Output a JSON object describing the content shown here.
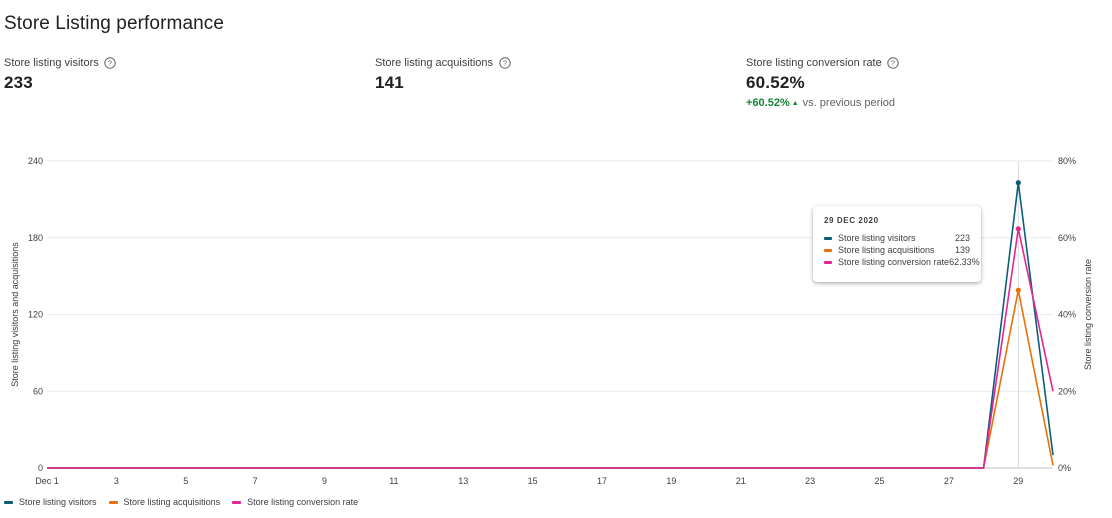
{
  "page": {
    "title": "Store Listing performance"
  },
  "metrics": [
    {
      "label": "Store listing visitors",
      "value": "233",
      "icon": "help-circle-icon"
    },
    {
      "label": "Store listing acquisitions",
      "value": "141",
      "icon": "help-circle-icon"
    },
    {
      "label": "Store listing conversion rate",
      "value": "60.52%",
      "icon": "help-circle-icon",
      "delta": {
        "value": "+60.52%",
        "direction": "up",
        "suffix": "vs. previous period",
        "color": "#188038"
      }
    }
  ],
  "tooltip": {
    "date": "29 DEC 2020",
    "rows": [
      {
        "label": "Store listing visitors",
        "value": "223",
        "color": "#0b5f76"
      },
      {
        "label": "Store listing acquisitions",
        "value": "139",
        "color": "#e8710a"
      },
      {
        "label": "Store listing conversion rate",
        "value": "62.33%",
        "color": "#e52592"
      }
    ]
  },
  "chart_data": {
    "type": "line",
    "x": [
      1,
      2,
      3,
      4,
      5,
      6,
      7,
      8,
      9,
      10,
      11,
      12,
      13,
      14,
      15,
      16,
      17,
      18,
      19,
      20,
      21,
      22,
      23,
      24,
      25,
      26,
      27,
      28,
      29,
      30
    ],
    "x_ticks": [
      1,
      3,
      5,
      7,
      9,
      11,
      13,
      15,
      17,
      19,
      21,
      23,
      25,
      27,
      29
    ],
    "x_tick_labels": [
      "Dec 1",
      "3",
      "5",
      "7",
      "9",
      "11",
      "13",
      "15",
      "17",
      "19",
      "21",
      "23",
      "25",
      "27",
      "29"
    ],
    "y_left": {
      "label": "Store listing visitors and acquisitions",
      "lim": [
        0,
        240
      ],
      "ticks": [
        0,
        60,
        120,
        180,
        240
      ],
      "tick_labels": [
        "0",
        "60",
        "120",
        "180",
        "240"
      ]
    },
    "y_right": {
      "label": "Store listing conversion rate",
      "lim": [
        0,
        80
      ],
      "ticks": [
        0,
        20,
        40,
        60,
        80
      ],
      "tick_labels": [
        "0%",
        "20%",
        "40%",
        "60%",
        "80%"
      ]
    },
    "grid": true,
    "legend_position": "bottom-left",
    "hover_x": 29,
    "series": [
      {
        "name": "Store listing visitors",
        "axis": "left",
        "color": "#0b5f76",
        "values": [
          0,
          0,
          0,
          0,
          0,
          0,
          0,
          0,
          0,
          0,
          0,
          0,
          0,
          0,
          0,
          0,
          0,
          0,
          0,
          0,
          0,
          0,
          0,
          0,
          0,
          0,
          0,
          0,
          223,
          10
        ]
      },
      {
        "name": "Store listing acquisitions",
        "axis": "left",
        "color": "#e8710a",
        "values": [
          0,
          0,
          0,
          0,
          0,
          0,
          0,
          0,
          0,
          0,
          0,
          0,
          0,
          0,
          0,
          0,
          0,
          0,
          0,
          0,
          0,
          0,
          0,
          0,
          0,
          0,
          0,
          0,
          139,
          2
        ]
      },
      {
        "name": "Store listing conversion rate",
        "axis": "right",
        "color": "#e52592",
        "values": [
          0,
          0,
          0,
          0,
          0,
          0,
          0,
          0,
          0,
          0,
          0,
          0,
          0,
          0,
          0,
          0,
          0,
          0,
          0,
          0,
          0,
          0,
          0,
          0,
          0,
          0,
          0,
          0,
          62.33,
          20
        ]
      }
    ]
  }
}
